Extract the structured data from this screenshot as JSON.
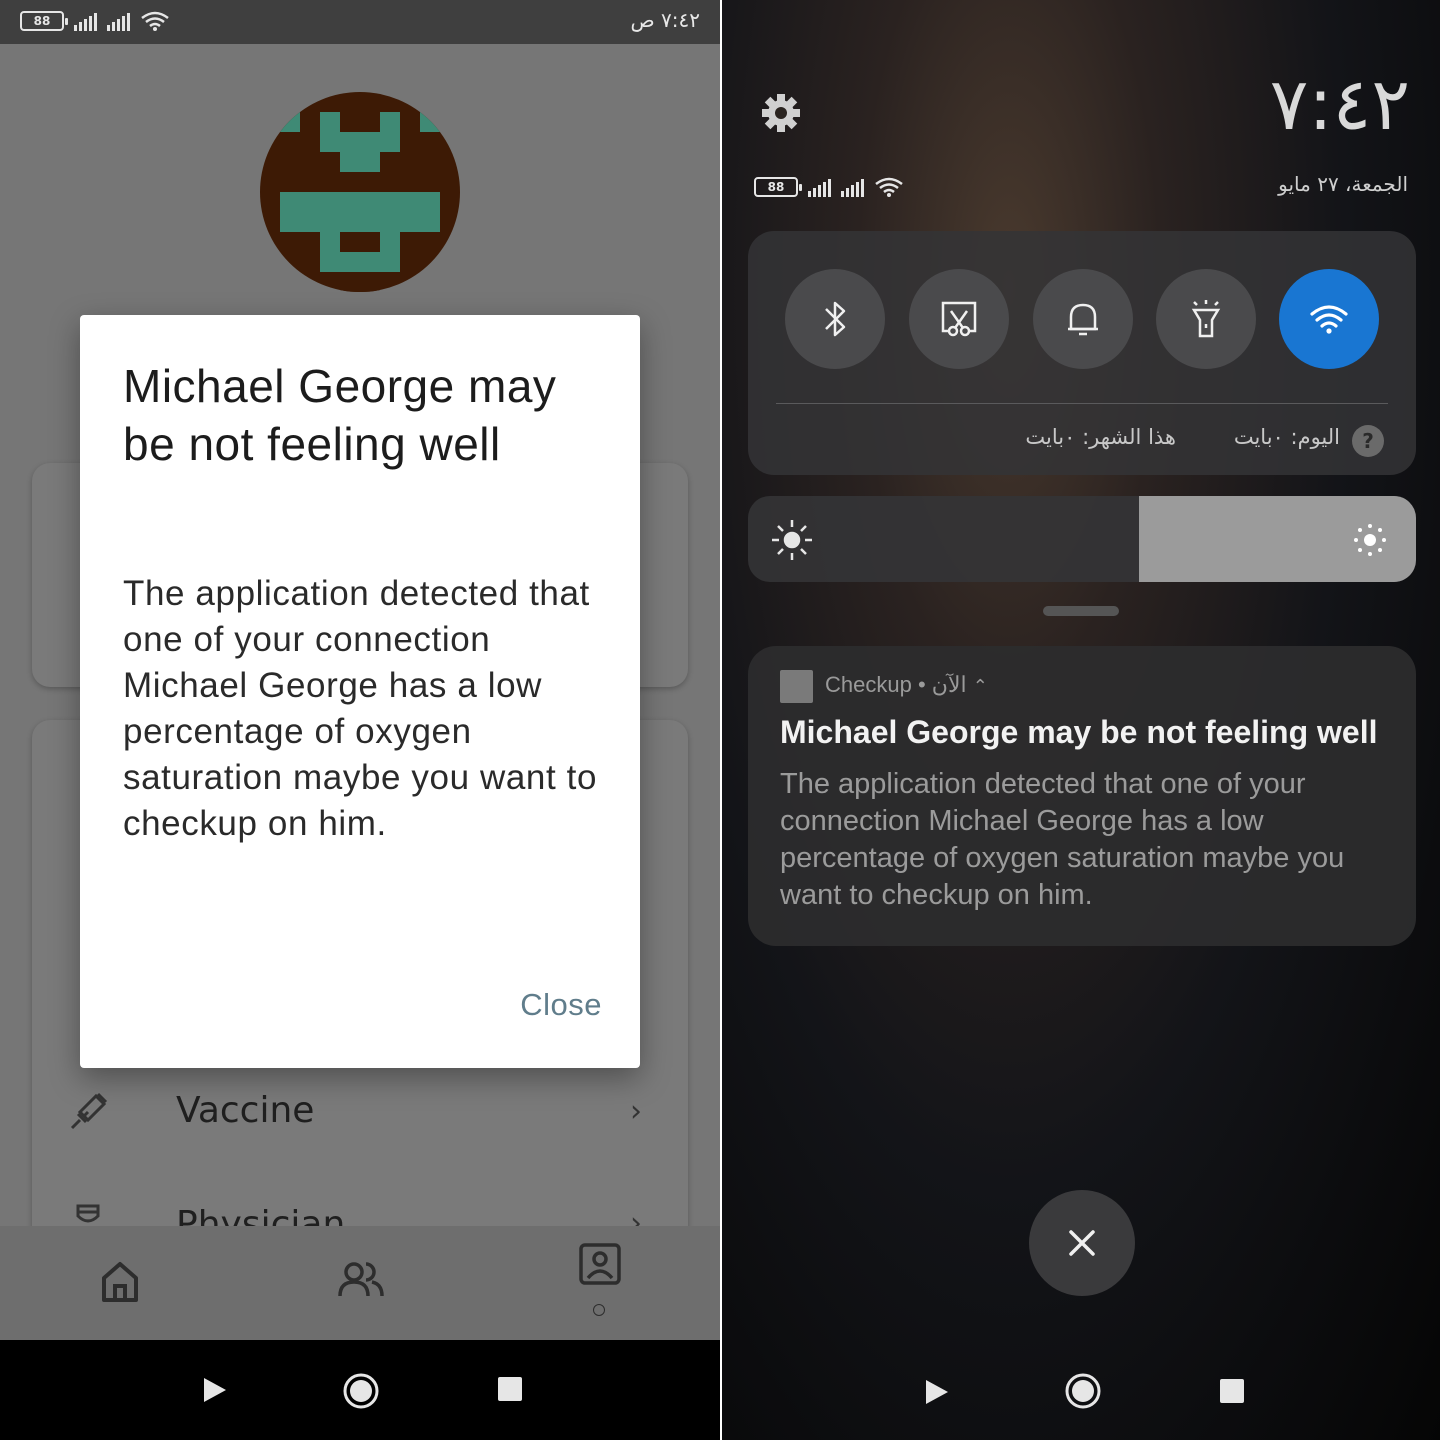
{
  "left": {
    "status_bar": {
      "time": "٧:٤٢ ص",
      "battery": "88"
    },
    "menu": {
      "vaccine_label": "Vaccine",
      "physician_label": "Physician"
    },
    "dialog": {
      "title": "Michael George may be not feeling well",
      "body": "The application detected that one of your connection Michael George  has a low percentage of oxygen saturation maybe you want to checkup on him.",
      "close_label": "Close"
    }
  },
  "right": {
    "clock": "٧:٤٢",
    "date": "الجمعة، ٢٧ مايو",
    "battery": "88",
    "data_usage": {
      "today": "اليوم: ٠بايت",
      "month": "هذا الشهر: ٠بايت",
      "help": "?"
    },
    "notification": {
      "app_name": "Checkup",
      "time": "الآن",
      "title": "Michael George  may be not feeling well",
      "body": "The application detected that one of your connection Michael George  has a low percentage of oxygen saturation maybe you want to checkup on him."
    }
  },
  "colors": {
    "accent_wifi": "#1976d2",
    "close_button": "#607d8b",
    "avatar_bg": "#3d1a05",
    "avatar_fg": "#3f8a75"
  }
}
